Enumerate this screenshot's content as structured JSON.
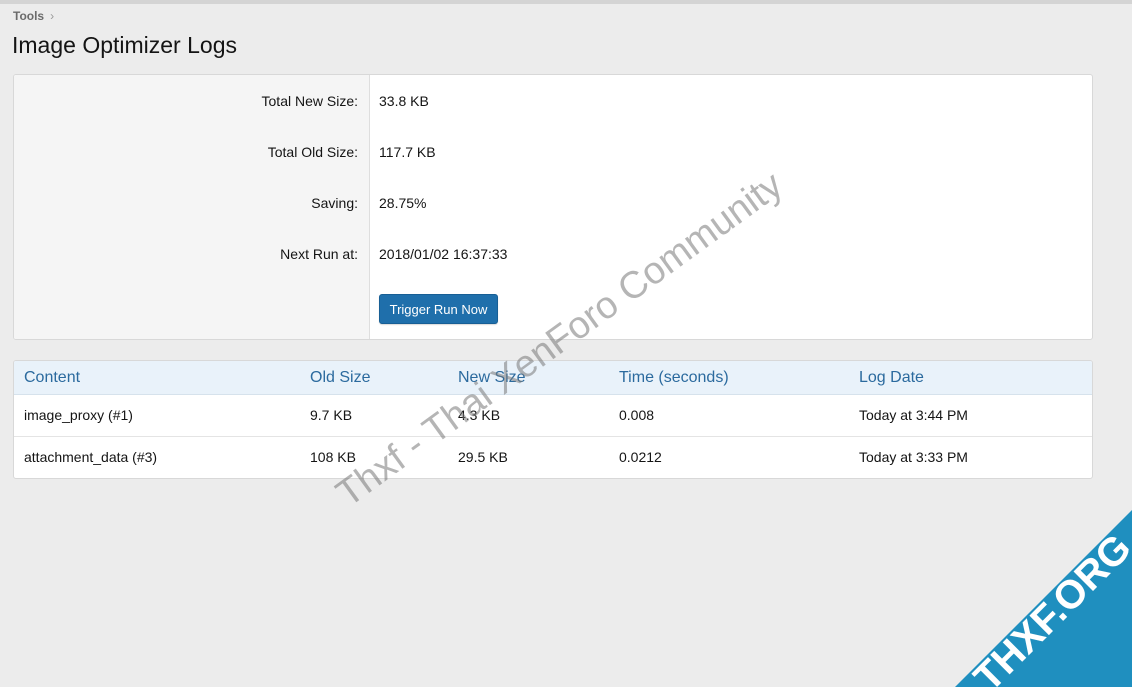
{
  "breadcrumb": {
    "label": "Tools",
    "separator": "›"
  },
  "page": {
    "title": "Image Optimizer Logs"
  },
  "summary": {
    "rows": [
      {
        "label": "Total New Size:",
        "value": "33.8 KB"
      },
      {
        "label": "Total Old Size:",
        "value": "117.7 KB"
      },
      {
        "label": "Saving:",
        "value": "28.75%"
      },
      {
        "label": "Next Run at:",
        "value": "2018/01/02 16:37:33"
      }
    ],
    "trigger_label": "Trigger Run Now"
  },
  "logs": {
    "columns": [
      "Content",
      "Old Size",
      "New Size",
      "Time (seconds)",
      "Log Date"
    ],
    "rows": [
      [
        "image_proxy (#1)",
        "9.7 KB",
        "4.3 KB",
        "0.008",
        "Today at 3:44 PM"
      ],
      [
        "attachment_data (#3)",
        "108 KB",
        "29.5 KB",
        "0.0212",
        "Today at 3:33 PM"
      ]
    ]
  },
  "watermark": {
    "text": "Thxf - Thai XenForo Community",
    "logo_text": "THXF.ORG"
  },
  "colors": {
    "accent": "#1f6fab",
    "header_bg": "#e9f2fa",
    "header_text": "#2b6a9e",
    "logo": "#1f8fbf"
  }
}
